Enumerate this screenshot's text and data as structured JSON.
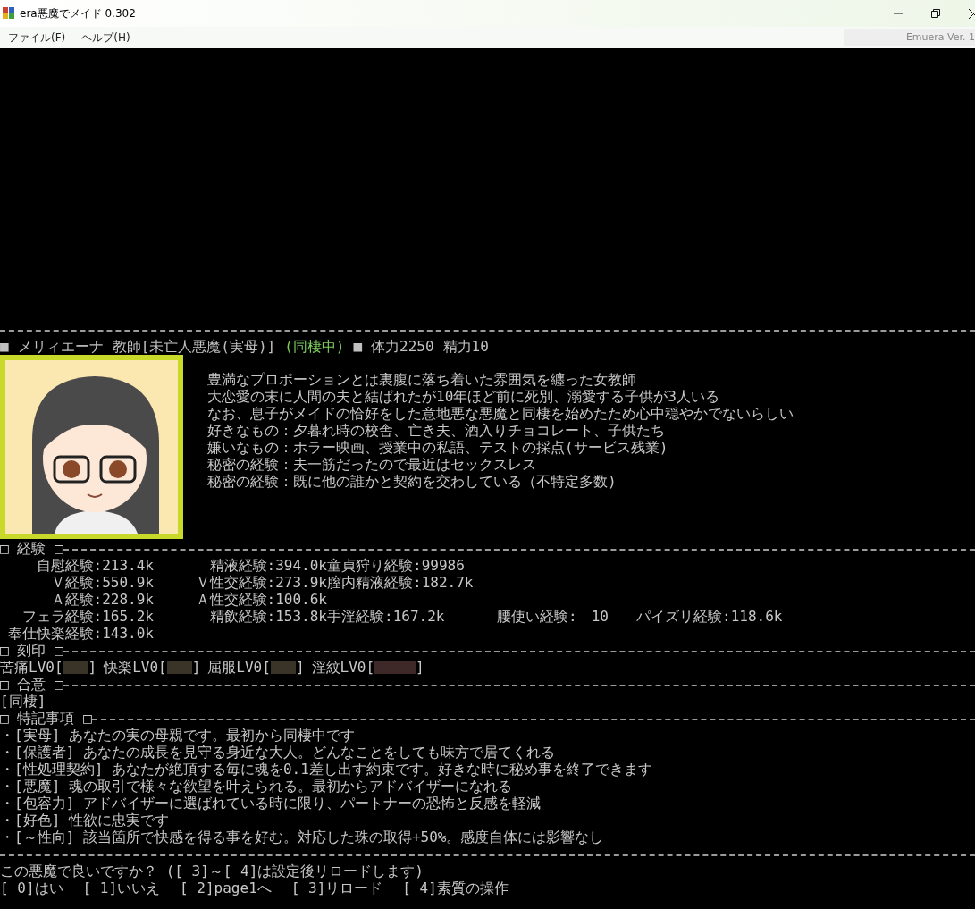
{
  "window": {
    "title": "era悪魔でメイド 0.302"
  },
  "menu": [
    "ファイル(F)",
    "ヘルプ(H)"
  ],
  "version": "Emuera Ver. 1",
  "header": [
    {
      "text": "■",
      "color": "#c0c0c0"
    },
    {
      "text": "メリィエーナ",
      "color": "#c0c0c0"
    },
    {
      "text": "教師[未亡人悪魔(実母)]",
      "color": "#c0c0c0"
    },
    {
      "text": "(同棲中)",
      "color": "#7ccc5c"
    },
    {
      "text": "■",
      "color": "#c0c0c0"
    },
    {
      "text": "体力2250",
      "color": "#c0c0c0"
    },
    {
      "text": "精力10",
      "color": "#c0c0c0"
    }
  ],
  "description": [
    "豊満なプロポーションとは裏腹に落ち着いた雰囲気を纏った女教師",
    "大恋愛の末に人間の夫と結ばれたが10年ほど前に死別、溺愛する子供が3人いる",
    "なお、息子がメイドの恰好をした意地悪な悪魔と同棲を始めたため心中穏やかでないらしい",
    "好きなもの：夕暮れ時の校舎、亡き夫、酒入りチョコレート、子供たち",
    "嫌いなもの：ホラー映画、授業中の私語、テストの採点(サービス残業)",
    "秘密の経験：夫一筋だったので最近はセックスレス",
    "秘密の経験：既に他の誰かと契約を交わしている（不特定多数)"
  ],
  "experience": {
    "title": "□ 経験 □",
    "rows": [
      [
        "自慰経験:213.4k",
        "精液経験:394.0k",
        "童貞狩り経験:99986"
      ],
      [
        "Ｖ経験:550.9k",
        "Ｖ性交経験:273.9k",
        "膣内精液経験:182.7k"
      ],
      [
        "Ａ経験:228.9k",
        "Ａ性交経験:100.6k"
      ],
      [
        "フェラ経験:165.2k",
        "精飲経験:153.8k",
        "手淫経験:167.2k",
        "腰使い経験:　10",
        "パイズリ経験:118.6k"
      ],
      [
        "奉仕快楽経験:143.0k"
      ]
    ]
  },
  "marks": {
    "title": "□ 刻印 □",
    "items": [
      {
        "label": "苦痛LV0[",
        "close": "]",
        "color": "#3a3328"
      },
      {
        "label": "快楽LV0[",
        "close": "]",
        "color": "#3a3328"
      },
      {
        "label": "屈服LV0[",
        "close": "]",
        "color": "#3a3328"
      },
      {
        "label": "淫紋LV0[",
        "close": "]",
        "color": "#3e2828"
      }
    ]
  },
  "consent": {
    "title": "□ 合意 □",
    "items": [
      "[同棲]"
    ]
  },
  "notes": {
    "title": "□ 特記事項 □",
    "items": [
      "・[実母] あなたの実の母親です。最初から同棲中です",
      "・[保護者] あなたの成長を見守る身近な大人。どんなことをしても味方で居てくれる",
      "・[性処理契約] あなたが絶頂する毎に魂を0.1差し出す約束です。好きな時に秘め事を終了できます",
      "・[悪魔] 魂の取引で様々な欲望を叶えられる。最初からアドバイザーになれる",
      "・[包容力] アドバイザーに選ばれている時に限り、パートナーの恐怖と反感を軽減",
      "・[好色] 性欲に忠実です",
      "・[～性向] 該当箇所で快感を得る事を好む。対応した珠の取得+50%。感度自体には影響なし"
    ]
  },
  "question": "この悪魔で良いですか？ ([ 3]～[ 4]は設定後リロードします)",
  "options": [
    "[ 0]はい",
    "[ 1]いいえ",
    "[ 2]page1へ",
    "[ 3]リロード",
    "[ 4]素質の操作"
  ]
}
